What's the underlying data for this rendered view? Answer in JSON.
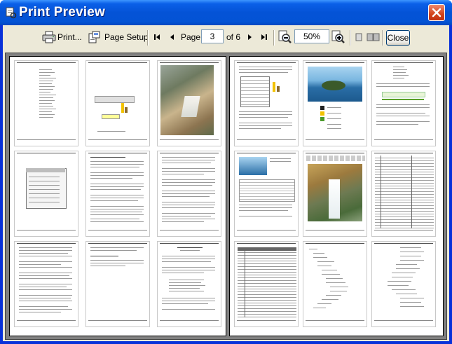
{
  "window": {
    "title": "Print Preview",
    "icons": {
      "app": "printer-app-icon",
      "close": "close-icon"
    }
  },
  "toolbar": {
    "print_label": "Print...",
    "page_setup_label": "Page Setup",
    "page_label": "Page",
    "page_value": "3",
    "of_label": "of 6",
    "zoom_value": "50%",
    "close_label": "Close",
    "icons": [
      "print-icon",
      "page-setup-icon",
      "first-page-icon",
      "previous-page-icon",
      "next-page-icon",
      "last-page-icon",
      "zoom-out-icon",
      "zoom-in-icon",
      "single-page-view-icon",
      "multi-page-view-icon"
    ]
  },
  "colors": {
    "title_bar": "#0453d6",
    "client_bg": "#ece9d8",
    "preview_bg": "#808080",
    "close_button": "#d2431a"
  }
}
